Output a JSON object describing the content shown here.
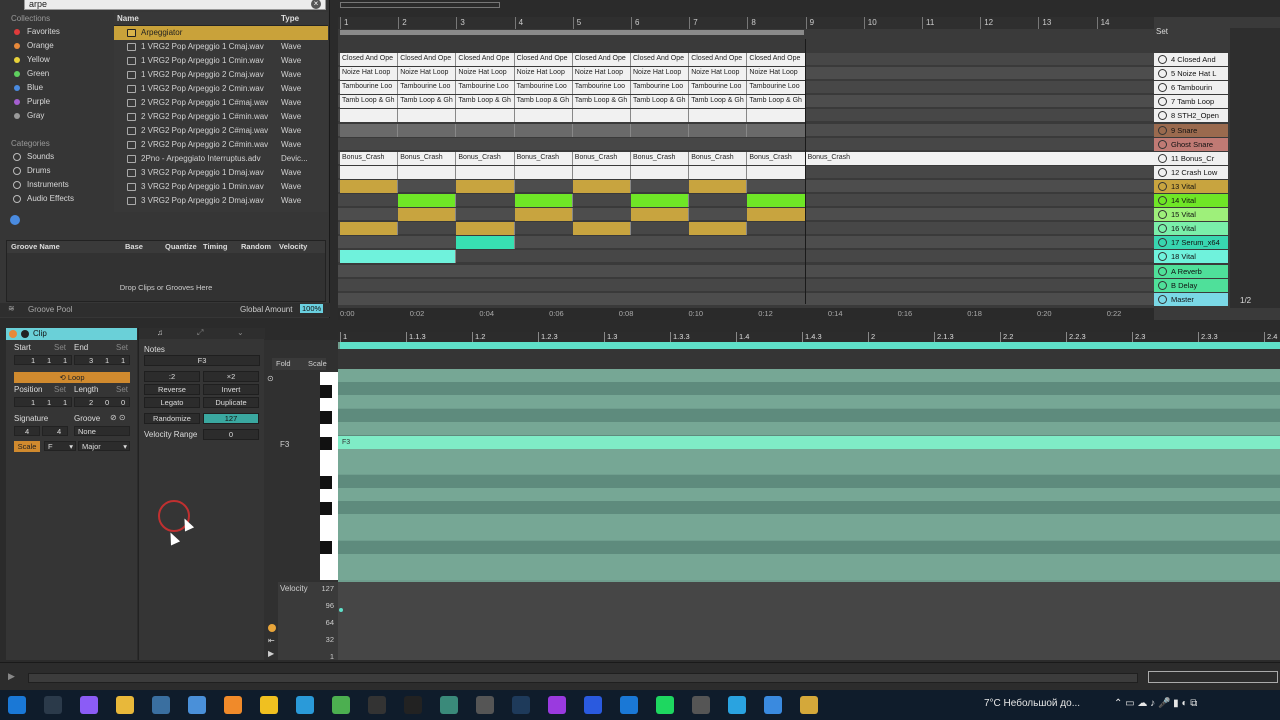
{
  "browser": {
    "search_value": "arpe",
    "collections_header": "Collections",
    "collections": [
      {
        "label": "Favorites",
        "color": "#e03b3b"
      },
      {
        "label": "Orange",
        "color": "#e8893a"
      },
      {
        "label": "Yellow",
        "color": "#e8d23a"
      },
      {
        "label": "Green",
        "color": "#5fd05f"
      },
      {
        "label": "Blue",
        "color": "#4a8be0"
      },
      {
        "label": "Purple",
        "color": "#a55fd0"
      },
      {
        "label": "Gray",
        "color": "#9a9a9a"
      }
    ],
    "categories_header": "Categories",
    "categories": [
      "Sounds",
      "Drums",
      "Instruments",
      "Audio Effects"
    ],
    "files_header_name": "Name",
    "files_header_type": "Type",
    "files": [
      {
        "name": "Arpeggiator",
        "type": "",
        "selected": true
      },
      {
        "name": "1 VRG2 Pop Arpeggio 1 Cmaj.wav",
        "type": "Wave"
      },
      {
        "name": "1 VRG2 Pop Arpeggio 1 Cmin.wav",
        "type": "Wave"
      },
      {
        "name": "1 VRG2 Pop Arpeggio 2 Cmaj.wav",
        "type": "Wave"
      },
      {
        "name": "1 VRG2 Pop Arpeggio 2 Cmin.wav",
        "type": "Wave"
      },
      {
        "name": "2 VRG2 Pop Arpeggio 1 C#maj.wav",
        "type": "Wave"
      },
      {
        "name": "2 VRG2 Pop Arpeggio 1 C#min.wav",
        "type": "Wave"
      },
      {
        "name": "2 VRG2 Pop Arpeggio 2 C#maj.wav",
        "type": "Wave"
      },
      {
        "name": "2 VRG2 Pop Arpeggio 2 C#min.wav",
        "type": "Wave"
      },
      {
        "name": "2Pno - Arpeggiato Interruptus.adv",
        "type": "Devic..."
      },
      {
        "name": "3 VRG2 Pop Arpeggio 1 Dmaj.wav",
        "type": "Wave"
      },
      {
        "name": "3 VRG2 Pop Arpeggio 1 Dmin.wav",
        "type": "Wave"
      },
      {
        "name": "3 VRG2 Pop Arpeggio 2 Dmaj.wav",
        "type": "Wave"
      }
    ],
    "groove_headers": [
      "Groove Name",
      "Base",
      "Quantize",
      "Timing",
      "Random",
      "Velocity"
    ],
    "groove_drop": "Drop Clips or Grooves Here",
    "groove_pool": "Groove Pool",
    "global_amount_label": "Global Amount",
    "global_amount_value": "100%"
  },
  "arrangement": {
    "bars": [
      "1",
      "2",
      "3",
      "4",
      "5",
      "6",
      "7",
      "8",
      "9",
      "10",
      "11",
      "12",
      "13",
      "14"
    ],
    "time_marks": [
      "0:00",
      "0:02",
      "0:04",
      "0:06",
      "0:08",
      "0:10",
      "0:12",
      "0:14",
      "0:16",
      "0:18",
      "0:20",
      "0:22"
    ],
    "set_label": "Set",
    "page_indicator": "1/2",
    "tracks": [
      {
        "name": "4 Closed And",
        "color": "#f0f0f0"
      },
      {
        "name": "5 Noize Hat L",
        "color": "#f0f0f0"
      },
      {
        "name": "6 Tambourin",
        "color": "#f0f0f0"
      },
      {
        "name": "7 Tamb Loop",
        "color": "#f0f0f0"
      },
      {
        "name": "8 STH2_Open",
        "color": "#f0f0f0"
      },
      {
        "name": "9 Snare",
        "color": "#9a6a4e"
      },
      {
        "name": "Ghost Snare",
        "color": "#c07a74"
      },
      {
        "name": "11 Bonus_Cr",
        "color": "#f0f0f0"
      },
      {
        "name": "12 Crash Low",
        "color": "#f0f0f0"
      },
      {
        "name": "13 Vital",
        "color": "#c8a43f"
      },
      {
        "name": "14 Vital",
        "color": "#6fe626"
      },
      {
        "name": "15 Vital",
        "color": "#9ef07a"
      },
      {
        "name": "16 Vital",
        "color": "#7aefaa"
      },
      {
        "name": "17 Serum_x64",
        "color": "#38d6b0"
      },
      {
        "name": "18 Vital",
        "color": "#6ff2dc"
      },
      {
        "name": "A Reverb",
        "color": "#4fe09a"
      },
      {
        "name": "B Delay",
        "color": "#4fe09a"
      },
      {
        "name": "Master",
        "color": "#7ad8e6"
      }
    ],
    "clip_names": {
      "closed": "Closed And Ope",
      "noize": "Noize Hat Loop",
      "tamb": "Tambourine Loo",
      "tamb2": "Tamb Loop & Gh",
      "crash": "Bonus_Crash"
    }
  },
  "clip": {
    "title": "Clip",
    "start_label": "Start",
    "set_label": "Set",
    "end_label": "End",
    "start_value": [
      "1",
      "1",
      "1"
    ],
    "end_value": [
      "3",
      "1",
      "1"
    ],
    "loop_label": "Loop",
    "position_label": "Position",
    "length_label": "Length",
    "position_value": [
      "1",
      "1",
      "1"
    ],
    "length_value": [
      "2",
      "0",
      "0"
    ],
    "signature_label": "Signature",
    "groove_label": "Groove",
    "sig_num": "4",
    "sig_den": "4",
    "groove_value": "None",
    "scale_label": "Scale",
    "scale_root": "F",
    "scale_mode": "Major"
  },
  "notes": {
    "title": "Notes",
    "pitch": "F3",
    "btn_half": ":2",
    "btn_double": "×2",
    "reverse": "Reverse",
    "invert": "Invert",
    "legato": "Legato",
    "duplicate": "Duplicate",
    "randomize": "Randomize",
    "randomize_value": "127",
    "velocity_range": "Velocity Range",
    "velocity_range_value": "0",
    "fold": "Fold",
    "scale": "Scale",
    "key_label": "F3"
  },
  "pianoroll": {
    "beats": [
      "1",
      "1.1.3",
      "1.2",
      "1.2.3",
      "1.3",
      "1.3.3",
      "1.4",
      "1.4.3",
      "2",
      "2.1.3",
      "2.2",
      "2.2.3",
      "2.3",
      "2.3.3",
      "2.4"
    ],
    "note_label": "F3",
    "velocity_label": "Velocity",
    "velocity_ticks": [
      "127",
      "96",
      "64",
      "32",
      "1"
    ]
  },
  "taskbar": {
    "weather": "7°C  Небольшой до...",
    "apps": [
      "start",
      "search",
      "copilot",
      "files",
      "monitor",
      "folder",
      "search2",
      "notes",
      "grid",
      "chrome",
      "live-old",
      "live",
      "app1",
      "app2",
      "app3",
      "ae",
      "ps",
      "three",
      "spotify",
      "app4",
      "telegram",
      "box",
      "app5"
    ]
  }
}
